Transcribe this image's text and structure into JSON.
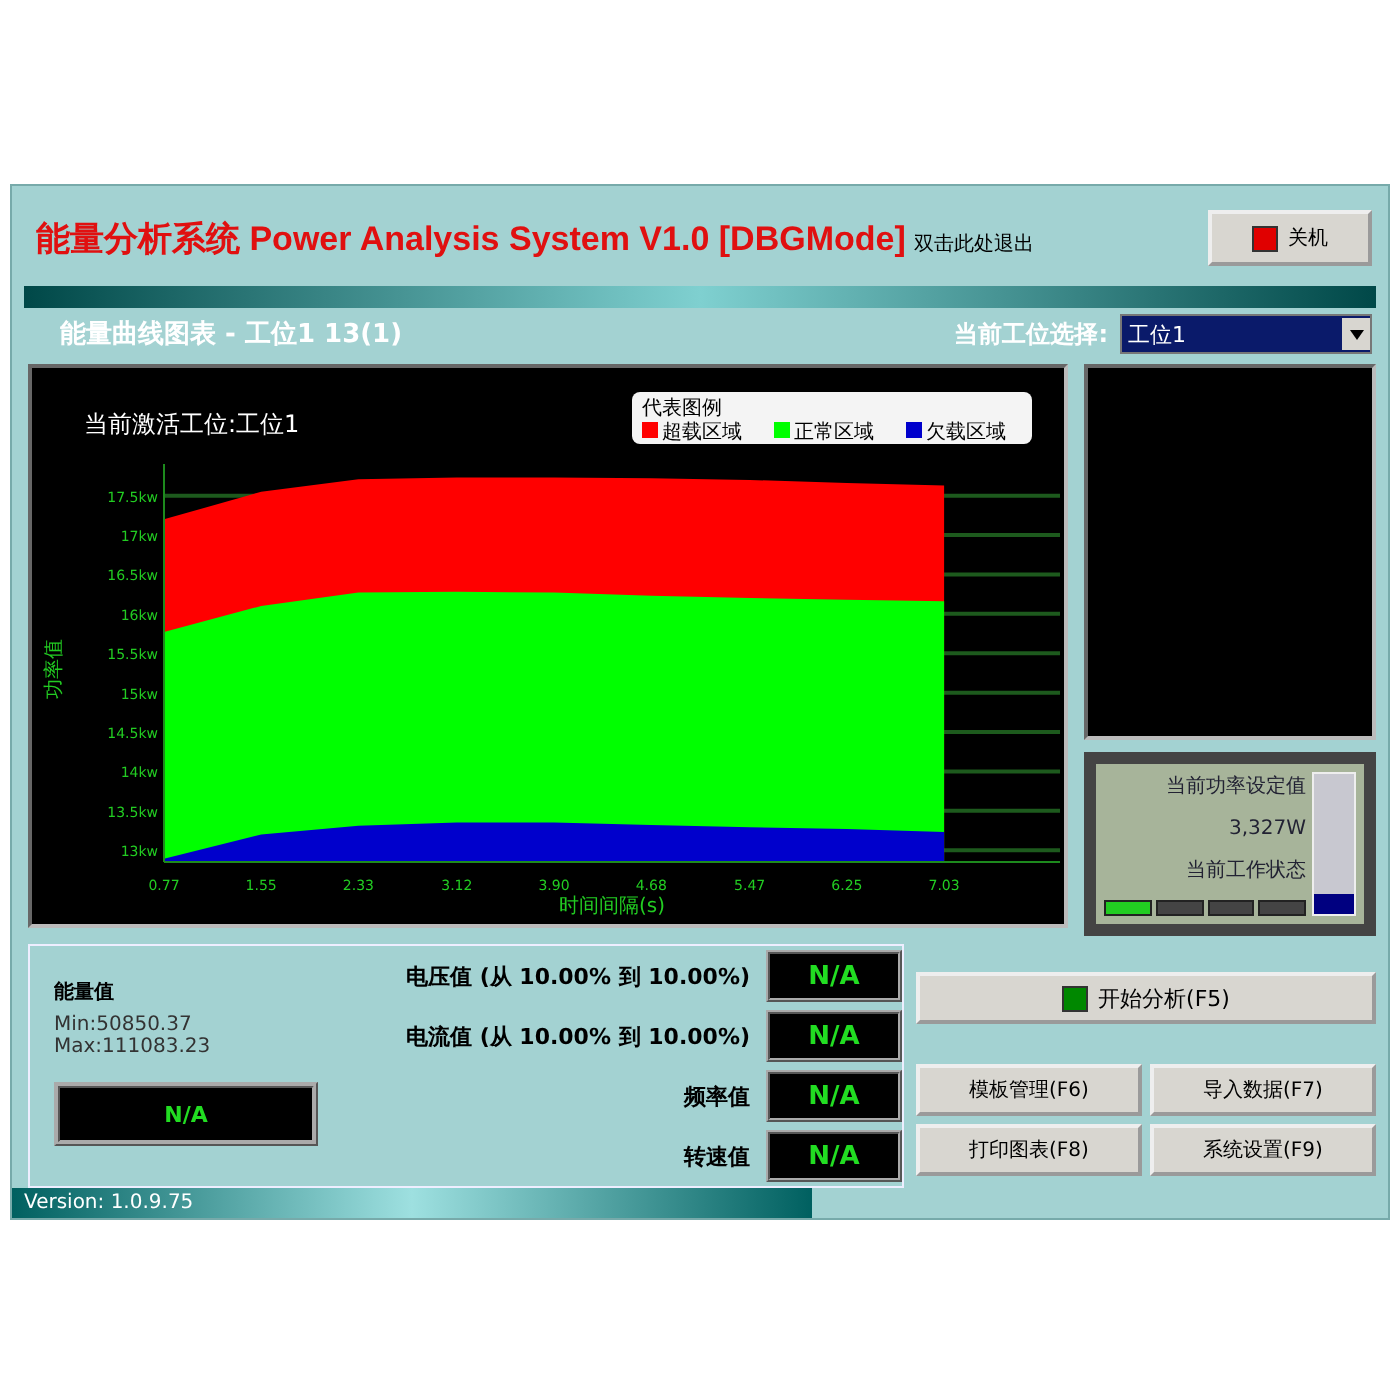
{
  "header": {
    "title": "能量分析系统 Power Analysis System V1.0 [DBGMode]",
    "overlay_note": "双击此处退出",
    "shutdown_button": "关机"
  },
  "subheader": {
    "title": "能量曲线图表 - 工位1  13(1)",
    "station_label": "当前工位选择:",
    "station_value": "工位1"
  },
  "chart_panel": {
    "heading": "当前激活工位:工位1",
    "legend_title": "代表图例",
    "chart_data": {
      "type": "area",
      "grid": true,
      "legend": true,
      "xlabel": "时间间隔(s)",
      "ylabel": "功率值",
      "x": [
        0.77,
        1.55,
        2.33,
        3.12,
        3.9,
        4.68,
        5.47,
        6.25,
        7.03
      ],
      "series": [
        {
          "name": "超载区域",
          "color": "#ff0000",
          "values": [
            17.2,
            17.55,
            17.71,
            17.73,
            17.73,
            17.72,
            17.7,
            17.66,
            17.63
          ]
        },
        {
          "name": "正常区域",
          "color": "#00ff00",
          "values": [
            15.77,
            16.1,
            16.27,
            16.28,
            16.27,
            16.23,
            16.2,
            16.18,
            16.16
          ]
        },
        {
          "name": "欠载区域",
          "color": "#0000cc",
          "values": [
            12.89,
            13.2,
            13.31,
            13.35,
            13.35,
            13.32,
            13.29,
            13.27,
            13.23
          ]
        }
      ],
      "xlim": [
        0.77,
        7.96
      ],
      "ylim": [
        12.85,
        17.75
      ],
      "xticks": [
        {
          "value": 0.77,
          "label": "0.77"
        },
        {
          "value": 1.55,
          "label": "1.55"
        },
        {
          "value": 2.33,
          "label": "2.33"
        },
        {
          "value": 3.12,
          "label": "3.12"
        },
        {
          "value": 3.9,
          "label": "3.90"
        },
        {
          "value": 4.68,
          "label": "4.68"
        },
        {
          "value": 5.47,
          "label": "5.47"
        },
        {
          "value": 6.25,
          "label": "6.25"
        },
        {
          "value": 7.03,
          "label": "7.03"
        }
      ],
      "yticks": [
        {
          "value": 13,
          "label": "13kw"
        },
        {
          "value": 13.5,
          "label": "13.5kw"
        },
        {
          "value": 14,
          "label": "14kw"
        },
        {
          "value": 14.5,
          "label": "14.5kw"
        },
        {
          "value": 15,
          "label": "15kw"
        },
        {
          "value": 15.5,
          "label": "15.5kw"
        },
        {
          "value": 16,
          "label": "16kw"
        },
        {
          "value": 16.5,
          "label": "16.5kw"
        },
        {
          "value": 17,
          "label": "17kw"
        },
        {
          "value": 17.5,
          "label": "17.5kw"
        }
      ]
    }
  },
  "status_panel": {
    "setpoint_label": "当前功率设定值",
    "setpoint_value": "3,327W",
    "state_label": "当前工作状态",
    "level": 0.15,
    "segments": [
      {
        "on": true
      },
      {
        "on": false
      },
      {
        "on": false
      },
      {
        "on": false
      }
    ]
  },
  "energy": {
    "label": "能量值",
    "min": "Min:50850.37",
    "max": "Max:111083.23",
    "display": "N/A"
  },
  "readings": [
    {
      "label": "电压值 (从 10.00% 到 10.00%)",
      "value": "N/A"
    },
    {
      "label": "电流值 (从 10.00% 到 10.00%)",
      "value": "N/A"
    },
    {
      "label": "频率值",
      "value": "N/A"
    },
    {
      "label": "转速值",
      "value": "N/A"
    }
  ],
  "start_button": "开始分析(F5)",
  "buttons": [
    "模板管理(F6)",
    "导入数据(F7)",
    "打印图表(F8)",
    "系统设置(F9)"
  ],
  "version": "Version: 1.0.9.75"
}
